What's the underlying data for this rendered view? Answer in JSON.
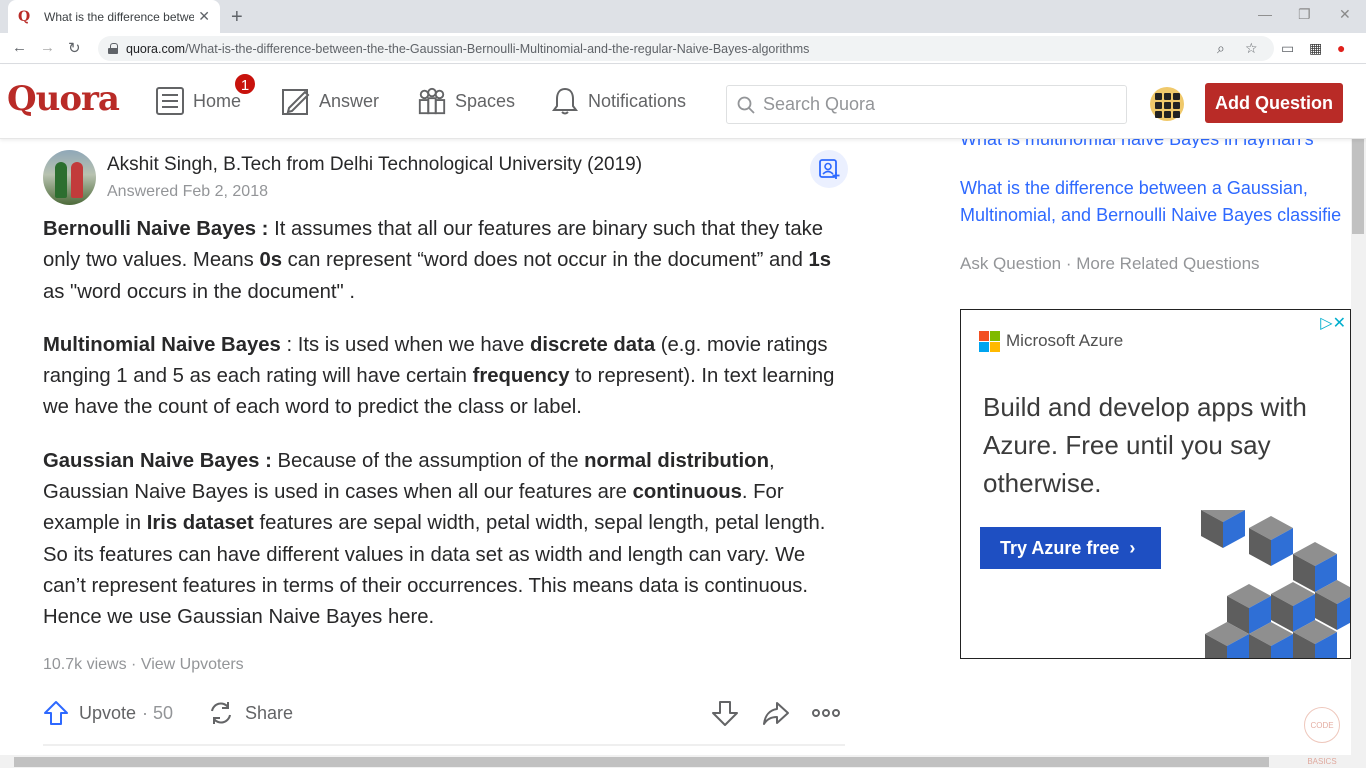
{
  "browser": {
    "tab_title": "What is the difference between t",
    "favicon": "Q",
    "url_host": "quora.com",
    "url_path": "/What-is-the-difference-between-the-the-Gaussian-Bernoulli-Multinomial-and-the-regular-Naive-Bayes-algorithms"
  },
  "header": {
    "logo": "Quora",
    "nav": {
      "home": "Home",
      "answer": "Answer",
      "spaces": "Spaces",
      "notifications": "Notifications"
    },
    "home_badge": "1",
    "search_placeholder": "Search Quora",
    "add_question": "Add Question"
  },
  "answer": {
    "author": "Akshit Singh, B.Tech from Delhi Technological University (2019)",
    "answered": "Answered Feb 2, 2018",
    "p1": {
      "term": "Bernoulli Naive Bayes :",
      "t1": " It assumes that all our features are binary such that they take only two values. Means ",
      "b1": "0s",
      "t2": " can represent “word does not occur in the document” and ",
      "b2": "1s",
      "t3": " as \"word occurs in the document\" ."
    },
    "p2": {
      "term": "Multinomial Naive Bayes",
      "t1": " : Its is used when we have ",
      "b1": "discrete data",
      "t2": " (e.g. movie ratings ranging 1 and 5 as each rating will have certain ",
      "b2": "frequency",
      "t3": " to represent). In text learning we have the count of each word to predict the class or label."
    },
    "p3": {
      "term": "Gaussian Naive Bayes :",
      "t1": " Because of the assumption of the ",
      "b1": "normal distribution",
      "t2": ", Gaussian Naive Bayes is used in cases when all our features are ",
      "b2": "continuous",
      "t3": ". For example in ",
      "b3": "Iris dataset",
      "t4": " features are sepal width, petal width, sepal length, petal length. So its features can have different values in data set as width and length can vary. We can’t represent features in terms of their occurrences. This means data is continuous. Hence we use Gaussian Naive Bayes here."
    },
    "views": "10.7k views · View Upvoters",
    "upvote_label": "Upvote",
    "upvote_count": "· 50",
    "share_label": "Share"
  },
  "sidebar": {
    "related_cut": "What is multinomial naive Bayes in layman's terms?",
    "related_2": "What is the difference between a Gaussian, Multinomial, and Bernoulli Naive Bayes classifie",
    "ask_more": "Ask Question · More Related Questions"
  },
  "ad": {
    "brand": "Microsoft Azure",
    "headline": "Build and develop apps with Azure. Free until you say otherwise.",
    "cta": "Try Azure free",
    "logo_colors": [
      "#f25022",
      "#7fba00",
      "#00a4ef",
      "#ffb900"
    ]
  },
  "watermark": "CODE BASICS",
  "colors": {
    "brand": "#b92b27",
    "link": "#2e69ff",
    "ad_button": "#1e4fc2"
  }
}
